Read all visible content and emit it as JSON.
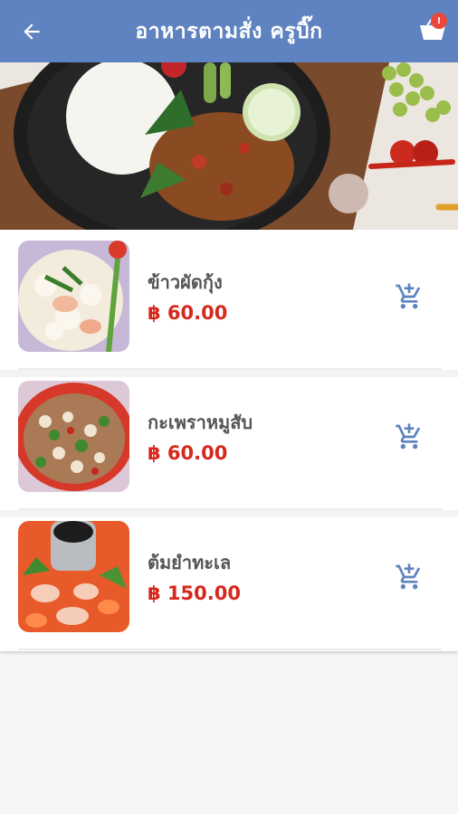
{
  "header": {
    "title": "อาหารตามสั่ง ครูบิ๊ก",
    "cart_badge": "!"
  },
  "items": [
    {
      "name": "ข้าวผัดกุ้ง",
      "price": "฿ 60.00",
      "image": "fried-rice-shrimp"
    },
    {
      "name": "กะเพราหมูสับ",
      "price": "฿ 60.00",
      "image": "basil-minced-pork"
    },
    {
      "name": "ต้มยำทะเล",
      "price": "฿ 150.00",
      "image": "tom-yum-seafood"
    }
  ],
  "colors": {
    "appbar": "#5f83c0",
    "price": "#d6281c",
    "accent_icon": "#5f83c0",
    "badge": "#e9473a"
  }
}
